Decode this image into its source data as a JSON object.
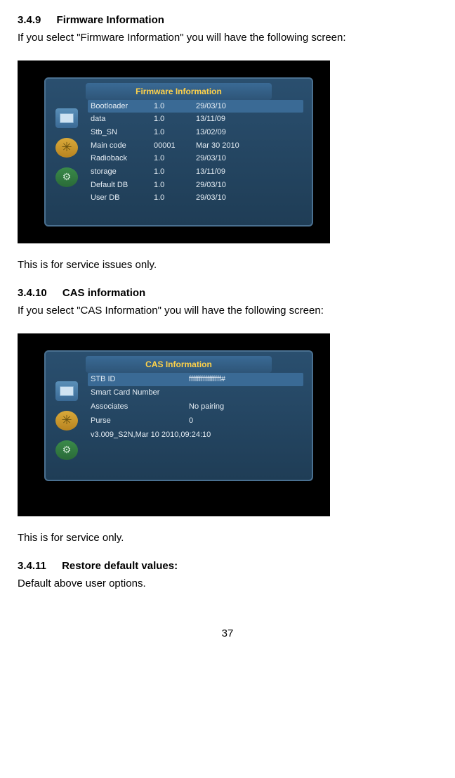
{
  "section1": {
    "number": "3.4.9",
    "title": "Firmware Information",
    "intro": "If you select \"Firmware Information\" you will have the following screen:",
    "outro": "This is for service issues only."
  },
  "firmware_panel": {
    "title": "Firmware Information",
    "rows": [
      {
        "name": "Bootloader",
        "ver": "1.0",
        "date": "29/03/10",
        "highlight": true
      },
      {
        "name": "data",
        "ver": "1.0",
        "date": "13/11/09"
      },
      {
        "name": "Stb_SN",
        "ver": "1.0",
        "date": "13/02/09"
      },
      {
        "name": "Main code",
        "ver": "00001",
        "date": "Mar 30 2010"
      },
      {
        "name": "Radioback",
        "ver": "1.0",
        "date": "29/03/10"
      },
      {
        "name": "storage",
        "ver": "1.0",
        "date": "13/11/09"
      },
      {
        "name": "Default DB",
        "ver": "1.0",
        "date": "29/03/10"
      },
      {
        "name": "User DB",
        "ver": "1.0",
        "date": "29/03/10"
      }
    ]
  },
  "section2": {
    "number": "3.4.10",
    "title": "CAS information",
    "intro": "If you select \"CAS Information\" you will have the following screen:",
    "outro": "This is for service only."
  },
  "cas_panel": {
    "title": "CAS Information",
    "rows": [
      {
        "name": "STB ID",
        "value": "ffffffffffffffff#",
        "highlight": true
      },
      {
        "name": "Smart Card Number",
        "value": ""
      },
      {
        "name": "Associates",
        "value": "No pairing"
      },
      {
        "name": "Purse",
        "value": "0"
      }
    ],
    "footer": "v3.009_S2N,Mar 10 2010,09:24:10"
  },
  "section3": {
    "number": "3.4.11",
    "title": "Restore default values:",
    "body": "Default above user options."
  },
  "page_number": "37"
}
